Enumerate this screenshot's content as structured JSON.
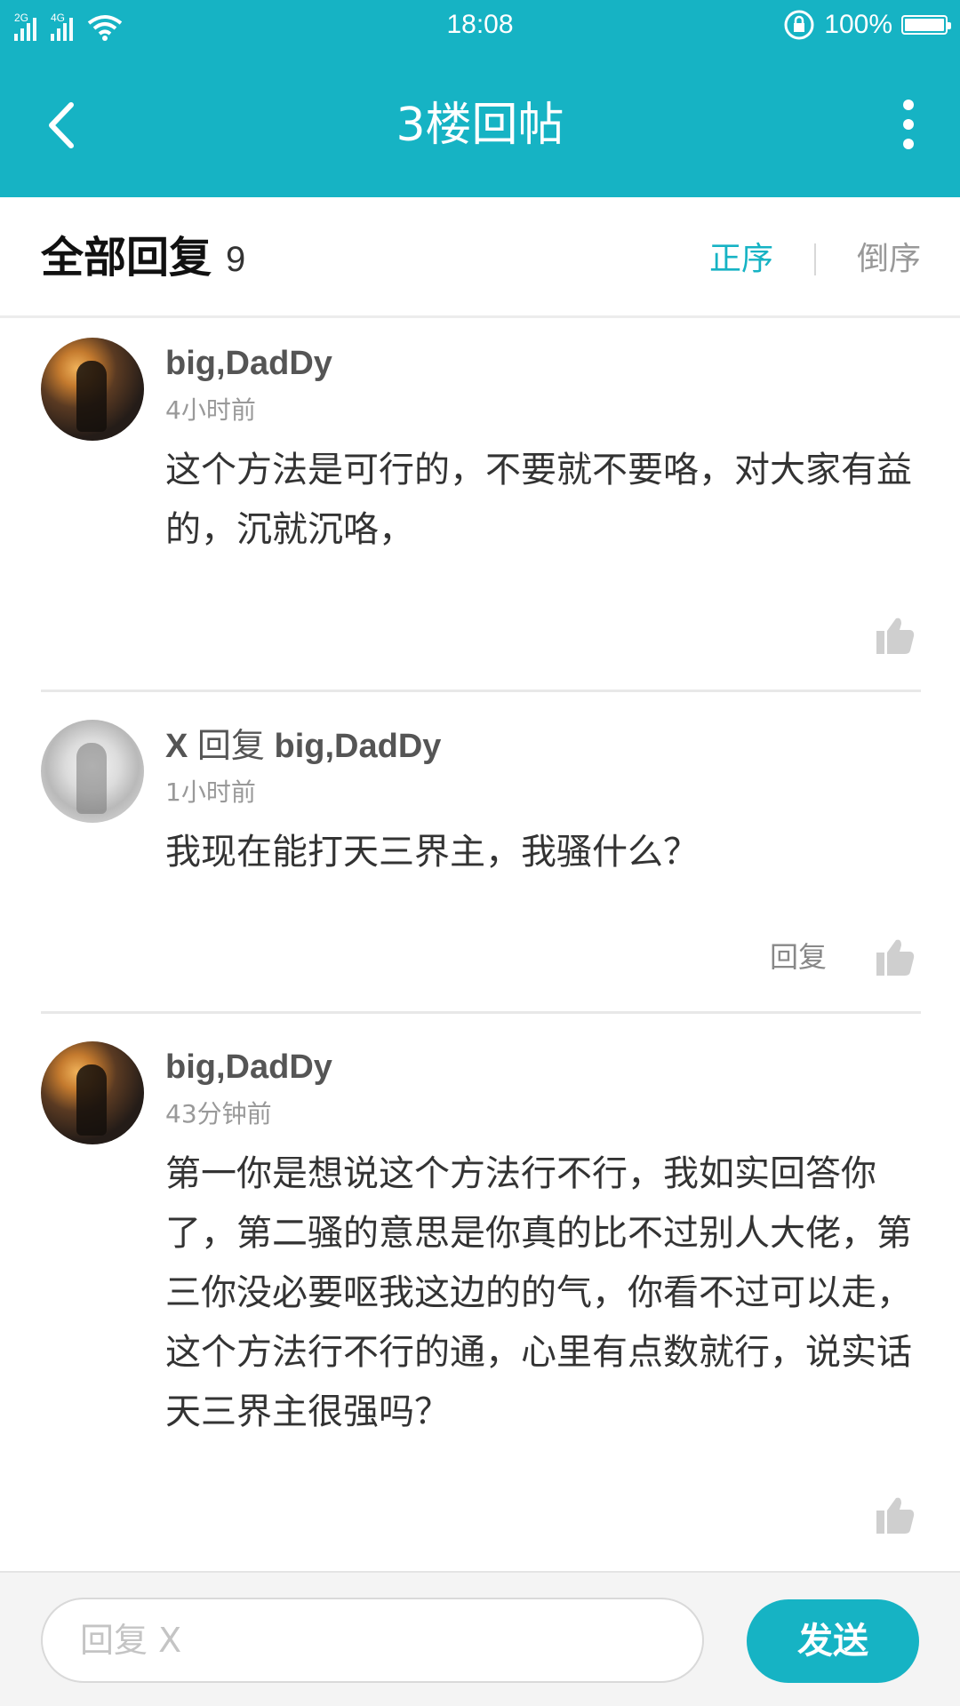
{
  "status_bar": {
    "network_1": "2G",
    "network_2": "4G",
    "time": "18:08",
    "battery": "100%"
  },
  "app_bar": {
    "title": "3楼回帖",
    "back_icon": "chevron-left-icon",
    "more_icon": "more-vertical-icon"
  },
  "header": {
    "title": "全部回复",
    "count": "9",
    "sort_asc": "正序",
    "sort_desc": "倒序"
  },
  "posts": [
    {
      "author": "big,DadDy",
      "time": "4小时前",
      "content": "这个方法是可行的，不要就不要咯，对大家有益的，沉就沉咯，"
    },
    {
      "author": "X",
      "reply_word": "回复",
      "reply_to": "big,DadDy",
      "time": "1小时前",
      "content": "我现在能打天三界主，我骚什么？",
      "reply_button": "回复"
    },
    {
      "author": "big,DadDy",
      "time": "43分钟前",
      "content": "第一你是想说这个方法行不行，我如实回答你了，第二骚的意思是你真的比不过别人大佬，第三你没必要呕我这边的的气，你看不过可以走，这个方法行不行的通，心里有点数就行，说实话天三界主很强吗？"
    }
  ],
  "bottom_bar": {
    "input_placeholder": "回复 X",
    "send_label": "发送"
  },
  "colors": {
    "accent": "#16b3c4",
    "text": "#333333",
    "muted": "#999999"
  }
}
